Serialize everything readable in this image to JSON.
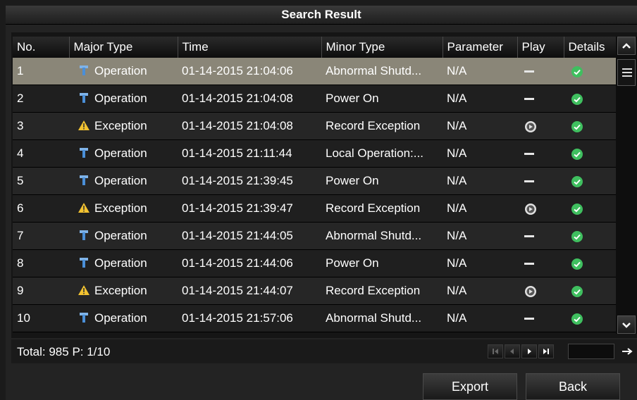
{
  "window": {
    "title": "Search Result"
  },
  "columns": [
    "No.",
    "Major Type",
    "Time",
    "Minor Type",
    "Parameter",
    "Play",
    "Details"
  ],
  "rows": [
    {
      "no": "1",
      "icon": "operation-icon",
      "major": "Operation",
      "time": "01-14-2015 21:04:06",
      "minor": "Abnormal Shutd...",
      "param": "N/A",
      "play": "none",
      "selected": true
    },
    {
      "no": "2",
      "icon": "operation-icon",
      "major": "Operation",
      "time": "01-14-2015 21:04:08",
      "minor": "Power On",
      "param": "N/A",
      "play": "none"
    },
    {
      "no": "3",
      "icon": "exception-icon",
      "major": "Exception",
      "time": "01-14-2015 21:04:08",
      "minor": "Record Exception",
      "param": "N/A",
      "play": "play"
    },
    {
      "no": "4",
      "icon": "operation-icon",
      "major": "Operation",
      "time": "01-14-2015 21:11:44",
      "minor": "Local Operation:...",
      "param": "N/A",
      "play": "none"
    },
    {
      "no": "5",
      "icon": "operation-icon",
      "major": "Operation",
      "time": "01-14-2015 21:39:45",
      "minor": "Power On",
      "param": "N/A",
      "play": "none"
    },
    {
      "no": "6",
      "icon": "exception-icon",
      "major": "Exception",
      "time": "01-14-2015 21:39:47",
      "minor": "Record Exception",
      "param": "N/A",
      "play": "play"
    },
    {
      "no": "7",
      "icon": "operation-icon",
      "major": "Operation",
      "time": "01-14-2015 21:44:05",
      "minor": "Abnormal Shutd...",
      "param": "N/A",
      "play": "none"
    },
    {
      "no": "8",
      "icon": "operation-icon",
      "major": "Operation",
      "time": "01-14-2015 21:44:06",
      "minor": "Power On",
      "param": "N/A",
      "play": "none"
    },
    {
      "no": "9",
      "icon": "exception-icon",
      "major": "Exception",
      "time": "01-14-2015 21:44:07",
      "minor": "Record Exception",
      "param": "N/A",
      "play": "play"
    },
    {
      "no": "10",
      "icon": "operation-icon",
      "major": "Operation",
      "time": "01-14-2015 21:57:06",
      "minor": "Abnormal Shutd...",
      "param": "N/A",
      "play": "none"
    }
  ],
  "footer": {
    "total": "Total: 985  P: 1/10",
    "page_input": ""
  },
  "buttons": {
    "export": "Export",
    "back": "Back"
  },
  "colors": {
    "selected_row": "#8a8678",
    "check_green": "#3fbf5f",
    "warning_yellow": "#f2c230",
    "operation_blue": "#4a8fd8"
  }
}
